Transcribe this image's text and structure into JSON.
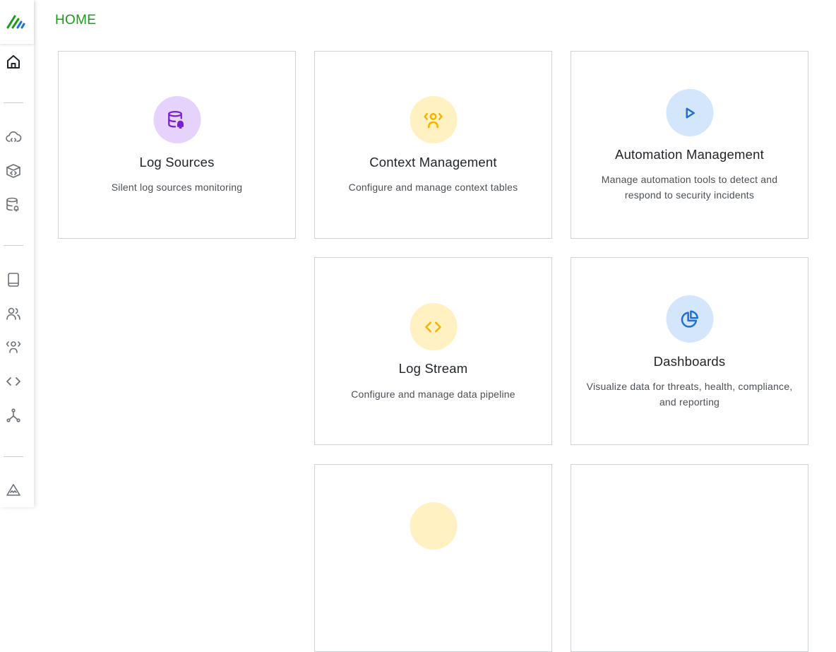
{
  "header": {
    "title": "HOME"
  },
  "sidebar": {
    "logo": "brand-logo",
    "items": [
      {
        "name": "home-icon"
      },
      {
        "name": "cloud-code-icon"
      },
      {
        "name": "box-code-icon"
      },
      {
        "name": "database-alert-icon"
      },
      {
        "name": "book-icon"
      },
      {
        "name": "users-icon"
      },
      {
        "name": "context-users-icon"
      },
      {
        "name": "code-icon"
      },
      {
        "name": "branch-icon"
      },
      {
        "name": "alert-triangle-icon"
      }
    ]
  },
  "cards": [
    {
      "title": "Log Sources",
      "desc": "Silent log sources monitoring",
      "icon": "database-alert-icon",
      "color": "#e6d3fb",
      "iconColor": "#7a1fd6"
    },
    {
      "title": "Context Management",
      "desc": "Configure and manage context tables",
      "icon": "context-users-icon",
      "color": "#fff1c2",
      "iconColor": "#f2b400"
    },
    {
      "title": "Automation Management",
      "desc": "Manage automation tools to detect and respond to security incidents",
      "icon": "play-icon",
      "color": "#d4e6fb",
      "iconColor": "#1e6fd6"
    },
    {
      "title": "Log Stream",
      "desc": "Configure and manage data pipeline",
      "icon": "code-icon",
      "color": "#fff1c2",
      "iconColor": "#f2b400"
    },
    {
      "title": "Dashboards",
      "desc": "Visualize data for threats, health, compliance, and reporting",
      "icon": "pie-chart-icon",
      "color": "#d4e6fb",
      "iconColor": "#1e6fd6"
    }
  ],
  "colors": {
    "accent": "#1a9c1a",
    "border": "#cfd3d8"
  }
}
